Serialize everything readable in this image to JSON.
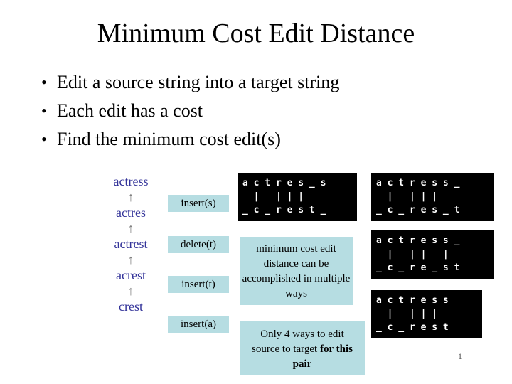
{
  "slide": {
    "title": "Minimum Cost Edit Distance",
    "page_number": "1",
    "accent_box_color": "#b6dde2",
    "chain_text_color": "#333399",
    "terminal_bg_color": "#000000",
    "terminal_fg_color": "#ffffff"
  },
  "bullets": [
    {
      "marker": "•",
      "text": "Edit a source string into a target string"
    },
    {
      "marker": "•",
      "text": "Each edit has a cost"
    },
    {
      "marker": "•",
      "text": "Find the minimum cost edit(s)"
    }
  ],
  "edit_chain": {
    "words": [
      "actress",
      "actres",
      "actrest",
      "acrest",
      "crest"
    ],
    "arrows": [
      "↑",
      "↑",
      "↑",
      "↑"
    ],
    "operations": [
      "insert(s)",
      "delete(t)",
      "insert(t)",
      "insert(a)"
    ]
  },
  "alignments": [
    {
      "top": "a c t r e s _ s",
      "middle": "  |   | | |    ",
      "bottom": "_ c _ r e s t _"
    },
    {
      "top": "a c t r e s s _",
      "middle": "  |   | | |    ",
      "bottom": "_ c _ r e s _ t"
    },
    {
      "top": "a c t r e s s _",
      "middle": "  |   | |   |  ",
      "bottom": "_ c _ r e _ s t"
    },
    {
      "top": "a c t r e s s",
      "middle": "  |   | | |  ",
      "bottom": "_ c _ r e s t"
    }
  ],
  "captions": {
    "minimum_cost": "minimum cost edit distance can be accomplished in multiple ways",
    "ways_prefix": "Only 4 ways to edit source to target ",
    "ways_bold": "for this pair"
  }
}
